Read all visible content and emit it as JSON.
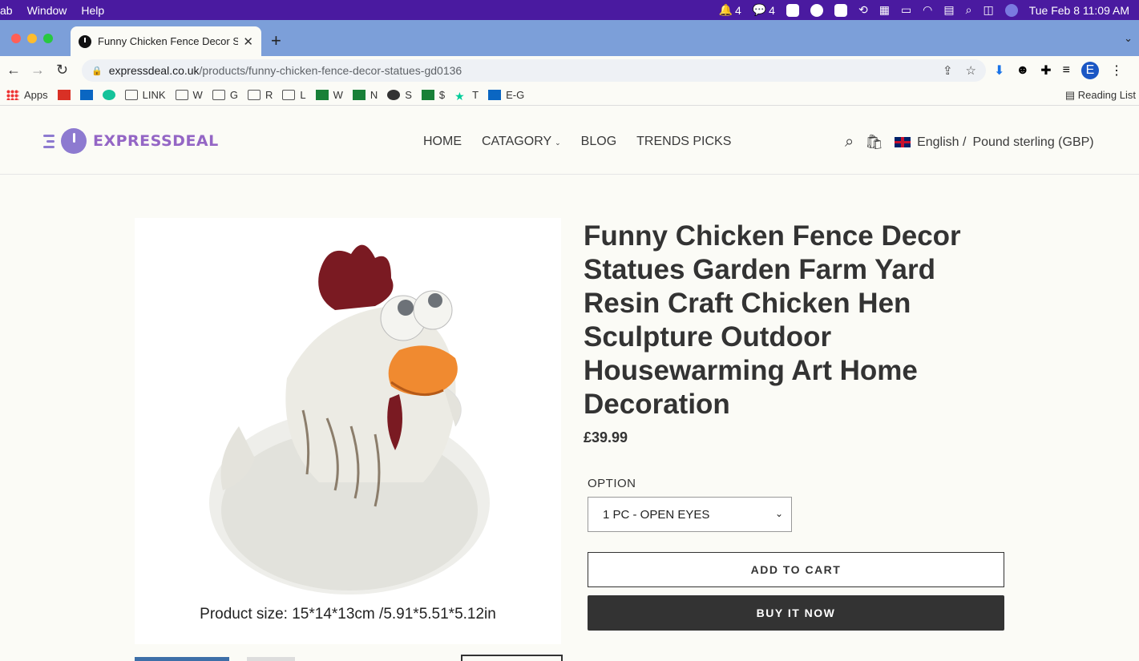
{
  "menubar": {
    "app_fragment": "ab",
    "menus": [
      "Window",
      "Help"
    ],
    "notif_count": "4",
    "wechat_count": "4",
    "datetime": "Tue Feb 8  11:09 AM"
  },
  "browser": {
    "tab_title": "Funny Chicken Fence Decor St",
    "url_host": "expressdeal.co.uk",
    "url_path": "/products/funny-chicken-fence-decor-statues-gd0136",
    "profile_initial": "E",
    "bookmarks": [
      {
        "label": "Apps",
        "icon": "apps-icon"
      },
      {
        "label": "",
        "icon": "gmail-icon"
      },
      {
        "label": "",
        "icon": "outlook-icon"
      },
      {
        "label": "",
        "icon": "grammarly-icon"
      },
      {
        "label": "LINK",
        "icon": "folder-icon"
      },
      {
        "label": "W",
        "icon": "folder-icon"
      },
      {
        "label": "G",
        "icon": "folder-icon"
      },
      {
        "label": "R",
        "icon": "folder-icon"
      },
      {
        "label": "L",
        "icon": "folder-icon"
      },
      {
        "label": "W",
        "icon": "sheets-icon"
      },
      {
        "label": "N",
        "icon": "sheets-icon"
      },
      {
        "label": "S",
        "icon": "globe-icon"
      },
      {
        "label": "$",
        "icon": "sheets-icon"
      },
      {
        "label": "T",
        "icon": "star-icon"
      },
      {
        "label": "E-G",
        "icon": "outlook-icon"
      }
    ],
    "reading_list": "Reading List"
  },
  "site": {
    "logo_text": "EXPRESSDEAL",
    "nav": [
      "HOME",
      "CATAGORY",
      "BLOG",
      "TRENDS PICKS"
    ],
    "language": "English /",
    "currency": "Pound sterling (GBP)"
  },
  "product": {
    "title": "Funny Chicken Fence Decor Statues Garden Farm Yard Resin Craft Chicken Hen Sculpture Outdoor Housewarming Art Home Decoration",
    "price": "£39.99",
    "option_label": "OPTION",
    "option_selected": "1 PC - OPEN EYES",
    "image_caption": "Product size: 15*14*13cm /5.91*5.51*5.12in",
    "add_to_cart": "ADD TO CART",
    "buy_now": "BUY IT NOW"
  },
  "colors": {
    "menubar": "#4a1aa0",
    "tabstrip": "#7c9fd9",
    "brand": "#9466c5",
    "buy_button": "#333333"
  }
}
